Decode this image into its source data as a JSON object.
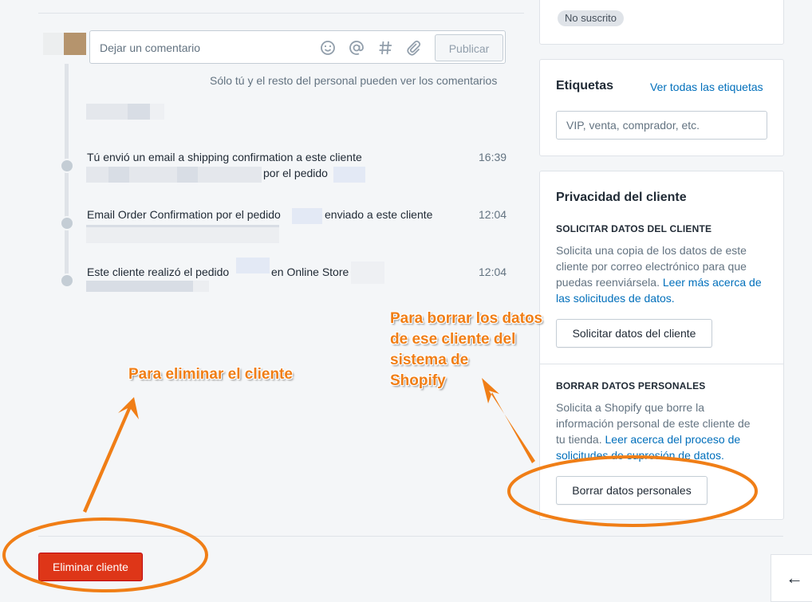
{
  "timeline": {
    "comment_placeholder": "Dejar un comentario",
    "publish_label": "Publicar",
    "staff_note": "Sólo tú y el resto del personal pueden ver los comentarios",
    "events": [
      {
        "text_a": "Tú envió un email a shipping confirmation a este cliente",
        "text_b": "por el pedido",
        "time": "16:39"
      },
      {
        "text_a": "Email Order Confirmation por el pedido",
        "text_b": "enviado a este cliente",
        "time": "12:04"
      },
      {
        "text_a": "Este cliente realizó el pedido",
        "text_b": "en Online Store",
        "time": "12:04"
      }
    ]
  },
  "icons": {
    "emoji": "smiley-icon",
    "mention": "at-icon",
    "hashtag": "hashtag-icon",
    "attach": "paperclip-icon",
    "back": "arrow-left-icon"
  },
  "subscription": {
    "badge": "No suscrito"
  },
  "tags": {
    "title": "Etiquetas",
    "view_all": "Ver todas las etiquetas",
    "placeholder": "VIP, venta, comprador, etc."
  },
  "privacy": {
    "title": "Privacidad del cliente",
    "request": {
      "heading": "SOLICITAR DATOS DEL CLIENTE",
      "line1": "Solicita una copia de los datos de este",
      "line2": "cliente por correo electrónico para que",
      "line3": "puedas reenviársela.",
      "link_a": "Leer más acerca de",
      "link_b": "las solicitudes de datos.",
      "button": "Solicitar datos del cliente"
    },
    "erase": {
      "heading": "BORRAR DATOS PERSONALES",
      "line1": "Solicita a Shopify que borre la",
      "line2": "información personal de este cliente de",
      "line3": "tu tienda.",
      "link_a": "Leer acerca del proceso de",
      "link_b": "solicitudes de supresión de datos.",
      "button": "Borrar datos personales"
    }
  },
  "footer": {
    "delete_button": "Eliminar cliente",
    "back_arrow": "←"
  },
  "annotations": {
    "left": "Para eliminar el cliente",
    "right_1": "Para borrar los datos",
    "right_2": "de ese cliente del",
    "right_3": "sistema de",
    "right_4": "Shopify"
  },
  "colors": {
    "accent_link": "#006fbb",
    "danger": "#de3618",
    "annotation": "#f07e16"
  }
}
